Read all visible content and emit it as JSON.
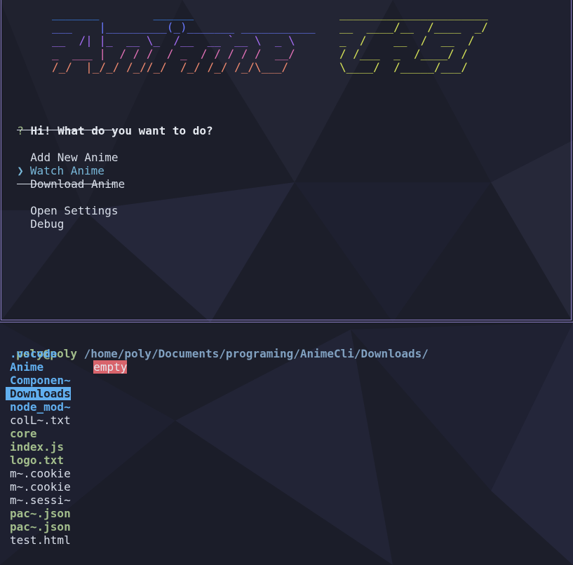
{
  "logo": {
    "anime_lines": [
      "_______        ______",
      "___    |_________(_)_______ ___________",
      "__  /| |_  __ \\_  /__  __ `__ \\  _ \\",
      "_  ___ |  / / /  / _  / / / / /  __/",
      "/_/  |_/_/ /_//_/  /_/ /_/ /_/\\___/"
    ],
    "cli_lines": [
      "______________________",
      "__  ____/__  /____  _/",
      "_  /    __  /  __  /",
      "/ /___  _  /____/ /",
      "\\____/  /_____/___/"
    ],
    "colors": [
      "#3d8bff",
      "#6a79ff",
      "#a26cf2",
      "#e271b7",
      "#f08a6f",
      "#f2b06a"
    ],
    "cli_color": "#d4e157"
  },
  "menu": {
    "question_mark": "?",
    "question": "Hi! What do you want to do?",
    "pointer": "❯",
    "options": [
      "Add New Anime",
      "Watch Anime",
      "Download Anime",
      "Open Settings",
      "Debug"
    ],
    "selected": "Watch Anime"
  },
  "file_manager": {
    "user": "poly@poly",
    "path": "/home/poly/Documents/programing/AnimeCli/Downloads/",
    "preview_status": "empty",
    "entries": [
      {
        "name": ".vscode",
        "type": "dir"
      },
      {
        "name": "Anime",
        "type": "dir"
      },
      {
        "name": "Componen~",
        "type": "dir"
      },
      {
        "name": "Downloads",
        "type": "dir-selected"
      },
      {
        "name": "node_mod~",
        "type": "dir"
      },
      {
        "name": "colL~.txt",
        "type": "file"
      },
      {
        "name": "core",
        "type": "exe"
      },
      {
        "name": "index.js",
        "type": "exe"
      },
      {
        "name": "logo.txt",
        "type": "exe"
      },
      {
        "name": "m~.cookie",
        "type": "file"
      },
      {
        "name": "m~.cookie",
        "type": "file"
      },
      {
        "name": "m~.sessi~",
        "type": "file"
      },
      {
        "name": "pac~.json",
        "type": "exe"
      },
      {
        "name": "pac~.json",
        "type": "exe"
      },
      {
        "name": "test.html",
        "type": "file"
      }
    ]
  },
  "colors": {
    "background": "#1c1e2a",
    "border": "#8e80c8",
    "directory": "#61afef",
    "executable": "#a3be8c",
    "selection_pointer": "#78b7d8",
    "empty_badge": "#d8646c"
  }
}
